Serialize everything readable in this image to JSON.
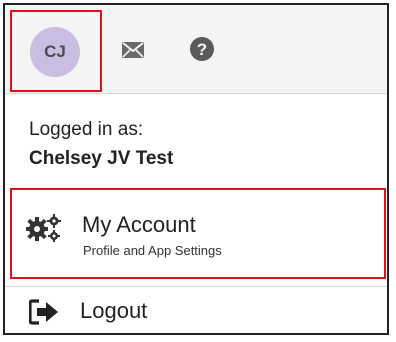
{
  "header": {
    "avatar_initials": "CJ",
    "avatar_color": "#c9bde2",
    "mail_icon": "envelope-icon",
    "help_icon": "question-circle-icon"
  },
  "user": {
    "logged_in_label": "Logged in as:",
    "name": "Chelsey JV Test"
  },
  "menu": {
    "account": {
      "title": "My Account",
      "subtitle": "Profile and App Settings",
      "icon": "gears-icon"
    },
    "logout": {
      "label": "Logout",
      "icon": "sign-out-icon"
    }
  },
  "colors": {
    "highlight_border": "#d9141c",
    "header_bg": "#f4f4f4",
    "icon_color": "#5a5a5a"
  }
}
